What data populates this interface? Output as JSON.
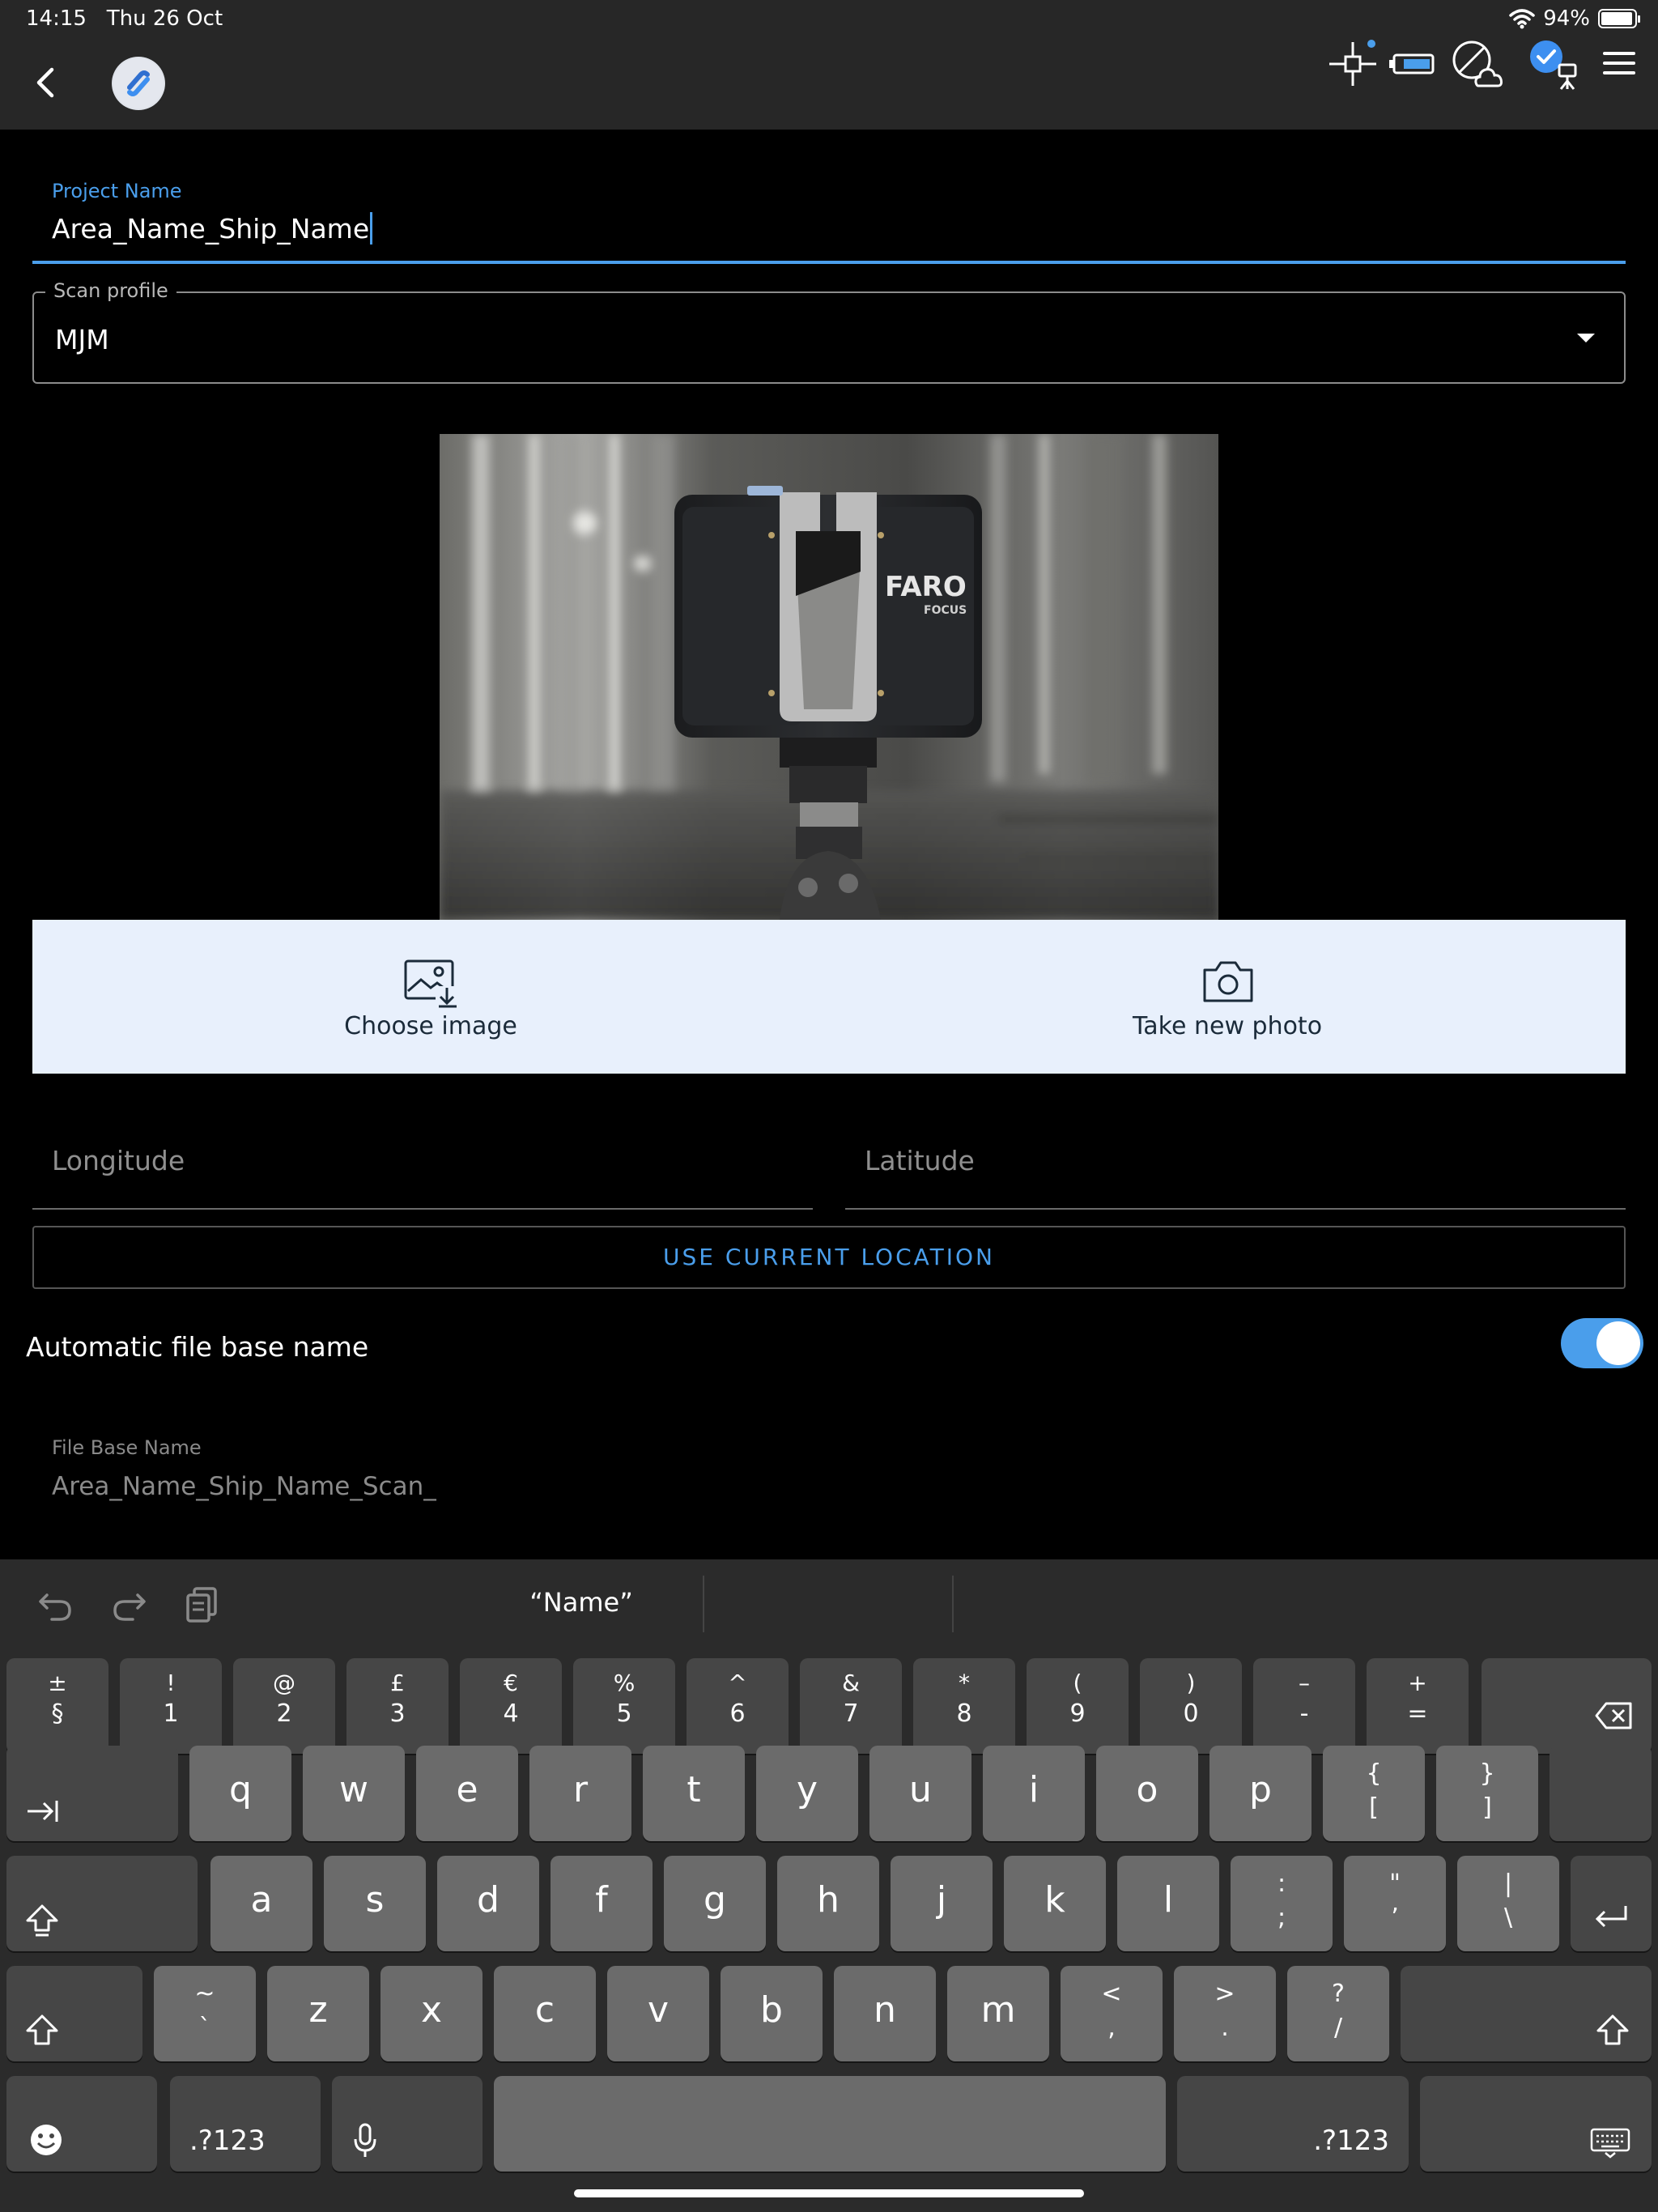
{
  "status_bar": {
    "time": "14:15",
    "date": "Thu 26 Oct",
    "battery": "94%",
    "battery_level": 0.94
  },
  "app_bar": {
    "back_icon": "chevron-left-icon",
    "logo_icon": "app-logo-icon",
    "icons": [
      "crosshair-target-icon",
      "scanner-battery-icon",
      "cloud-disabled-icon",
      "scanner-connected-icon",
      "hamburger-menu-icon"
    ]
  },
  "form": {
    "project_name_label": "Project Name",
    "project_name_value": "Area_Name_Ship_Name",
    "scan_profile_label": "Scan profile",
    "scan_profile_value": "MJM",
    "choose_image_label": "Choose image",
    "take_photo_label": "Take new photo",
    "longitude_placeholder": "Longitude",
    "latitude_placeholder": "Latitude",
    "use_location_label": "USE CURRENT LOCATION",
    "auto_file_label": "Automatic file base name",
    "auto_file_enabled": true,
    "file_base_label": "File Base Name",
    "file_base_value": "Area_Name_Ship_Name_Scan_"
  },
  "photo": {
    "brand_text": "FARO",
    "model_text": "FOCUS"
  },
  "keyboard": {
    "suggestion": "“Name”",
    "number_row": [
      {
        "up": "±",
        "down": "§"
      },
      {
        "up": "!",
        "down": "1"
      },
      {
        "up": "@",
        "down": "2"
      },
      {
        "up": "£",
        "down": "3"
      },
      {
        "up": "€",
        "down": "4"
      },
      {
        "up": "%",
        "down": "5"
      },
      {
        "up": "^",
        "down": "6"
      },
      {
        "up": "&",
        "down": "7"
      },
      {
        "up": "*",
        "down": "8"
      },
      {
        "up": "(",
        "down": "9"
      },
      {
        "up": ")",
        "down": "0"
      },
      {
        "up": "–",
        "down": "-"
      },
      {
        "up": "+",
        "down": "="
      }
    ],
    "row_q": [
      "q",
      "w",
      "e",
      "r",
      "t",
      "y",
      "u",
      "i",
      "o",
      "p"
    ],
    "row_q_extra": [
      {
        "up": "{",
        "down": "["
      },
      {
        "up": "}",
        "down": "]"
      }
    ],
    "row_a": [
      "a",
      "s",
      "d",
      "f",
      "g",
      "h",
      "j",
      "k",
      "l"
    ],
    "row_a_extra": [
      {
        "up": ":",
        "down": ";"
      },
      {
        "up": "\"",
        "down": "’"
      },
      {
        "up": "|",
        "down": "\\"
      }
    ],
    "row_z_tilde": {
      "up": "~",
      "down": "`"
    },
    "row_z": [
      "z",
      "x",
      "c",
      "v",
      "b",
      "n",
      "m"
    ],
    "row_z_extra": [
      {
        "up": "<",
        "down": ","
      },
      {
        "up": ">",
        "down": "."
      },
      {
        "up": "?",
        "down": "/"
      }
    ],
    "numbers_label": ".?123"
  },
  "colors": {
    "accent": "#4a9eeb",
    "bar": "#272727",
    "action_bg": "#e8f0fc"
  }
}
